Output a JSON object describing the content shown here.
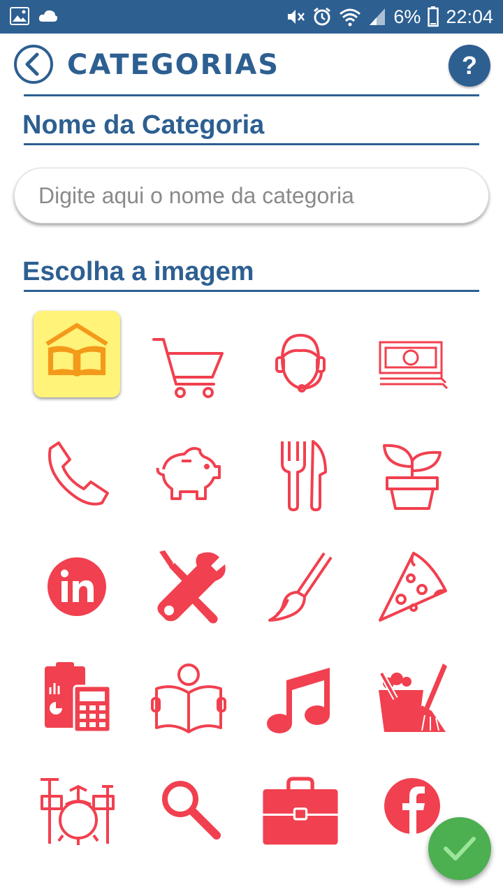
{
  "status_bar": {
    "battery": "6%",
    "time": "22:04",
    "icons": [
      "gallery-icon",
      "cloud-icon",
      "mute-icon",
      "alarm-icon",
      "wifi-icon",
      "signal-icon",
      "battery-icon"
    ]
  },
  "header": {
    "title": "CATEGORIAS",
    "back_icon": "back-arrow-icon",
    "help_label": "?"
  },
  "name_section": {
    "title": "Nome da Categoria",
    "input_placeholder": "Digite aqui o nome da categoria",
    "input_value": ""
  },
  "image_section": {
    "title": "Escolha a imagem",
    "selected_index": 0,
    "accent_color": "#f1404f",
    "selected_bg": "#fff37a",
    "images": [
      "house-book-icon",
      "shopping-cart-icon",
      "headset-support-icon",
      "money-bills-icon",
      "phone-icon",
      "piggy-bank-icon",
      "fork-knife-icon",
      "plant-pot-icon",
      "linkedin-icon",
      "tools-icon",
      "paint-brush-icon",
      "pizza-slice-icon",
      "calculator-chart-icon",
      "reading-person-icon",
      "music-note-icon",
      "cleaning-bucket-icon",
      "drum-kit-icon",
      "magnifier-icon",
      "briefcase-icon",
      "facebook-icon"
    ]
  },
  "confirm_button": {
    "icon": "check-icon",
    "color": "#4caf50"
  },
  "colors": {
    "primary": "#2d5f91",
    "accent": "#f1404f"
  }
}
